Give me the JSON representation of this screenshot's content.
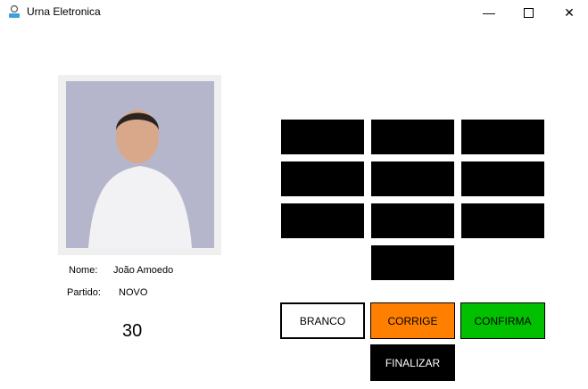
{
  "window": {
    "title": "Urna Eletronica",
    "icon": "user-icon",
    "controls": [
      "minimize",
      "maximize",
      "close"
    ]
  },
  "candidate": {
    "name_label": "Nome:",
    "name": "João Amoedo",
    "party_label": "Partido:",
    "party": "NOVO",
    "number": "30"
  },
  "keypad": {
    "keys": [
      "",
      "",
      "",
      "",
      "",
      "",
      "",
      "",
      "",
      ""
    ]
  },
  "actions": {
    "branco": "BRANCO",
    "corrige": "CORRIGE",
    "confirma": "CONFIRMA",
    "finalizar": "FINALIZAR"
  },
  "colors": {
    "corrige": "#ff8000",
    "confirma": "#00c000",
    "keys": "#000000"
  }
}
